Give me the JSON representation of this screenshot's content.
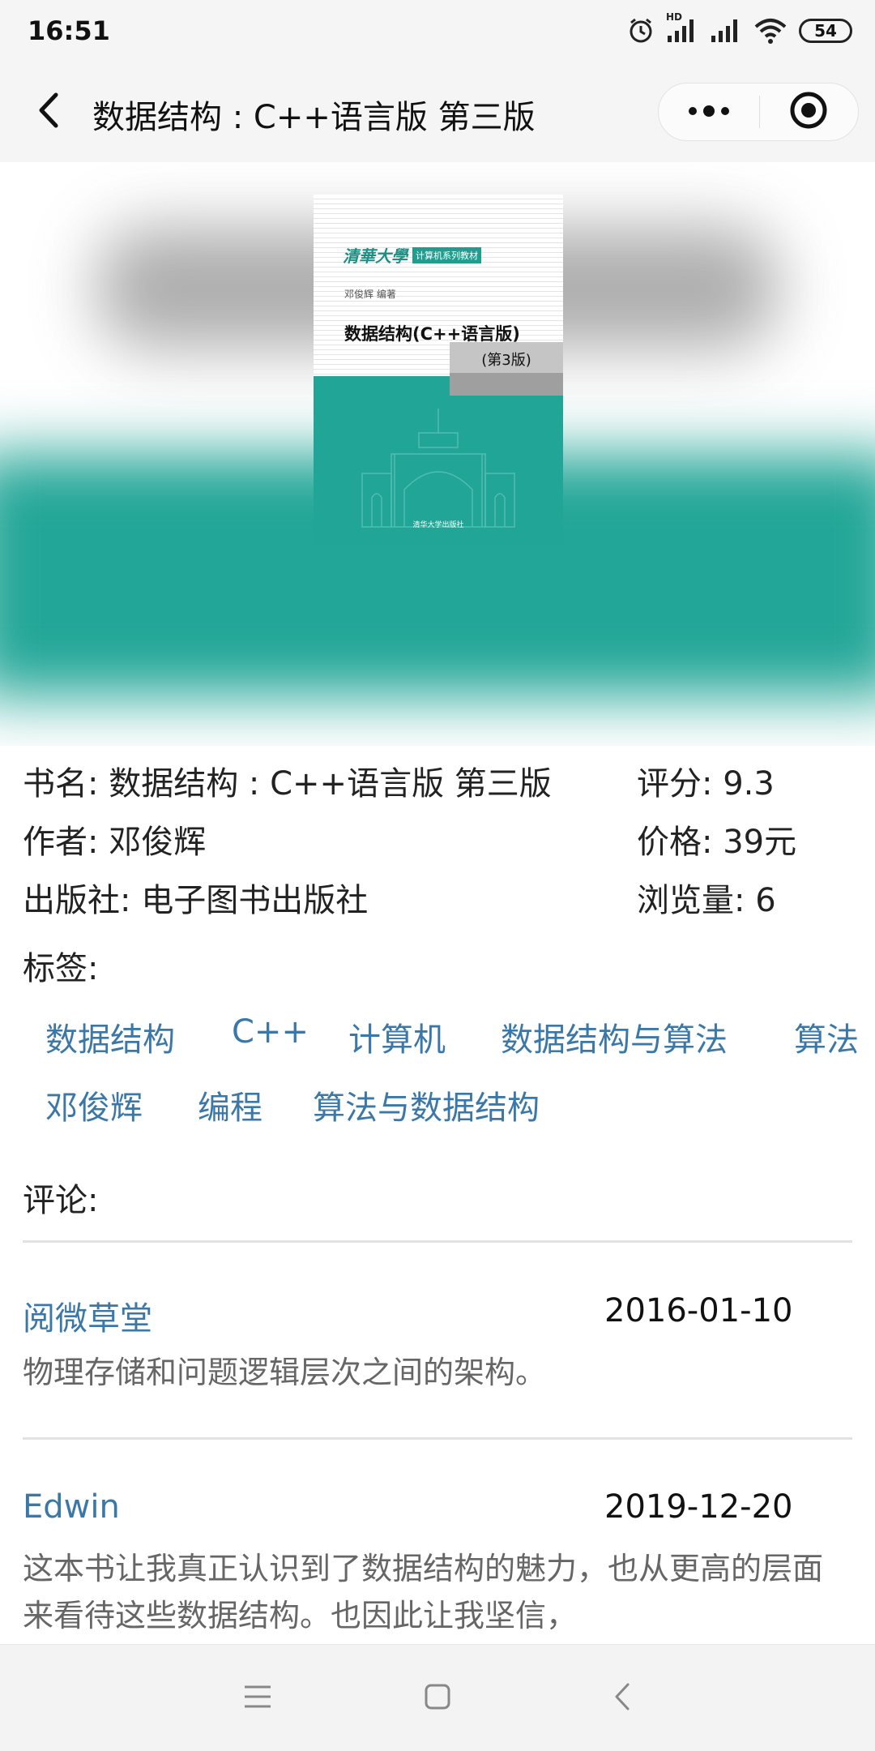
{
  "status_bar": {
    "time": "16:51",
    "hd_label": "HD",
    "battery": "54",
    "icons": [
      "alarm-icon",
      "cellular-signal-icon",
      "cellular-signal-icon",
      "wifi-icon",
      "battery-icon"
    ]
  },
  "nav": {
    "title": "数据结构 : C++语言版 第三版",
    "icons": [
      "back-icon",
      "more-icon",
      "close-miniprogram-icon"
    ]
  },
  "cover": {
    "university": "清華大學",
    "series": "计算机系列教材",
    "author": "邓俊辉 编著",
    "title": "数据结构(C++语言版)",
    "edition": "(第3版)",
    "publisher": "清华大学出版社",
    "colors": {
      "teal": "#21a596",
      "gray": "#c5c5c5"
    }
  },
  "info": {
    "book_name_label": "书名:",
    "book_name": "数据结构 : C++语言版 第三版",
    "rating_label": "评分:",
    "rating": "9.3",
    "author_label": "作者:",
    "author": "邓俊辉",
    "price_label": "价格:",
    "price": "39元",
    "publisher_label": "出版社:",
    "publisher": "电子图书出版社",
    "views_label": "浏览量:",
    "views": "6"
  },
  "tags": {
    "label": "标签:",
    "items": [
      "数据结构",
      "C++",
      "计算机",
      "数据结构与算法",
      "算法",
      "邓俊辉",
      "编程",
      "算法与数据结构"
    ]
  },
  "comments": {
    "label": "评论:",
    "items": [
      {
        "user": "阅微草堂",
        "date": "2016-01-10",
        "text": "物理存储和问题逻辑层次之间的架构。"
      },
      {
        "user": "Edwin",
        "date": "2019-12-20",
        "text": "这本书让我真正认识到了数据结构的魅力，也从更高的层面来看待这些数据结构。也因此让我坚信，"
      }
    ]
  },
  "system_nav": {
    "icons": [
      "menu-icon",
      "home-icon",
      "back-icon"
    ]
  },
  "colors": {
    "link": "#3b78a8",
    "text": "#222222",
    "bar_bg": "#f5f5f5"
  }
}
